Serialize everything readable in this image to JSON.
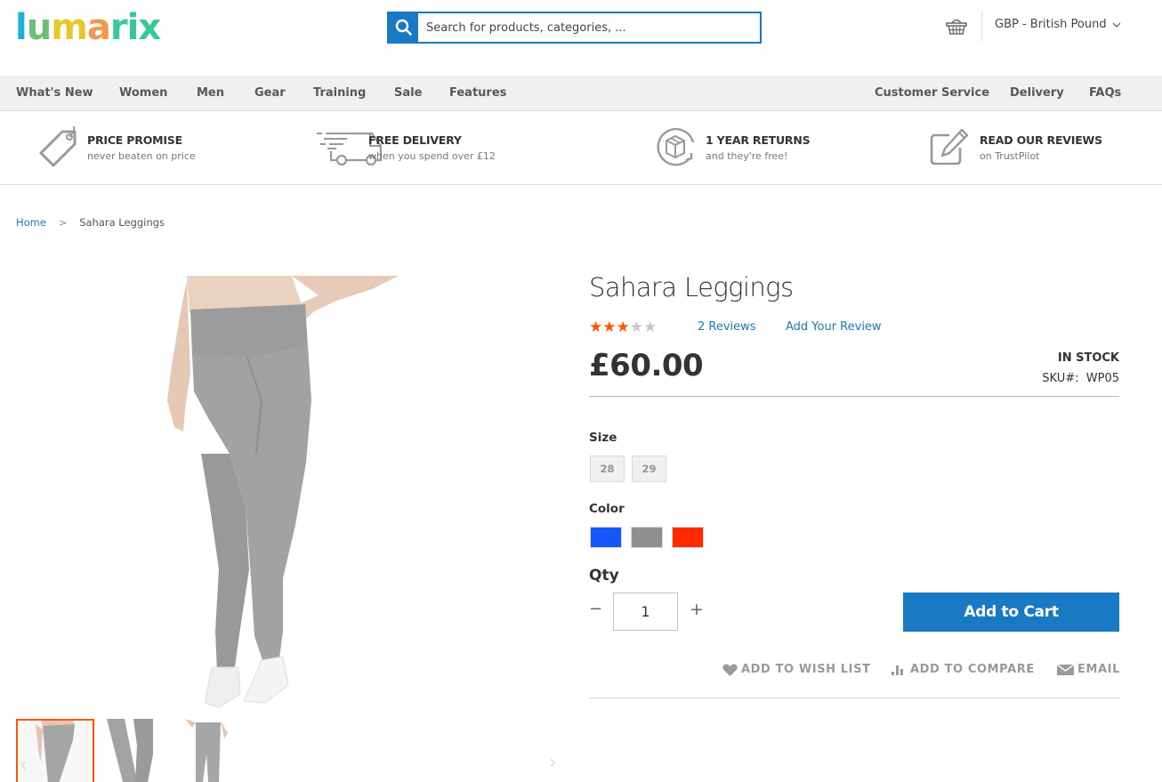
{
  "header": {
    "logo_letters": [
      {
        "char": "l",
        "color": "#1ab0e0"
      },
      {
        "char": "u",
        "color": "#6cc072"
      },
      {
        "char": "m",
        "color": "#e7c829"
      },
      {
        "char": "a",
        "color": "#f5984d"
      },
      {
        "char": "r",
        "color": "#3cc996"
      },
      {
        "char": "i",
        "color": "#35c995"
      },
      {
        "char": "x",
        "color": "#33ca97"
      }
    ],
    "search_placeholder": "Search for products, categories, ...",
    "currency_label": "GBP - British Pound"
  },
  "nav": {
    "left": [
      "What's New",
      "Women",
      "Men",
      "Gear",
      "Training",
      "Sale",
      "Features"
    ],
    "right": [
      "Customer Service",
      "Delivery",
      "FAQs"
    ]
  },
  "usp": [
    {
      "icon": "price-tag-icon",
      "title": "PRICE PROMISE",
      "subtitle": "never beaten on price"
    },
    {
      "icon": "delivery-truck-icon",
      "title": "FREE DELIVERY",
      "subtitle": "when you spend over £12"
    },
    {
      "icon": "returns-box-icon",
      "title": "1 YEAR RETURNS",
      "subtitle": "and they're free!"
    },
    {
      "icon": "pencil-edit-icon",
      "title": "READ OUR REVIEWS",
      "subtitle": "on TrustPilot"
    }
  ],
  "breadcrumb": {
    "home": "Home",
    "separator": ">",
    "current": "Sahara Leggings"
  },
  "product": {
    "name": "Sahara Leggings",
    "rating": {
      "stars_filled": 3,
      "stars_total": 5
    },
    "reviews_link": "2 Reviews",
    "add_review_link": "Add Your Review",
    "price": "£60.00",
    "stock_status": "IN STOCK",
    "sku_label": "SKU#:",
    "sku_value": "WP05",
    "size_label": "Size",
    "sizes": [
      "28",
      "29"
    ],
    "color_label": "Color",
    "colors": [
      {
        "name": "Blue",
        "hex": "#1857f7"
      },
      {
        "name": "Gray",
        "hex": "#8f8f8f"
      },
      {
        "name": "Red",
        "hex": "#ff2a00"
      }
    ],
    "qty_label": "Qty",
    "qty_value": "1",
    "qty_minus": "−",
    "qty_plus": "+",
    "add_to_cart": "Add to Cart",
    "actions": {
      "wishlist": "ADD TO WISH LIST",
      "compare": "ADD TO COMPARE",
      "email": "EMAIL"
    }
  },
  "gallery": {
    "thumbnail_count": 3,
    "active_index": 0
  },
  "colors": {
    "accent": "#1979c3",
    "star": "#ff5501",
    "thumb_active": "#ff5501"
  }
}
